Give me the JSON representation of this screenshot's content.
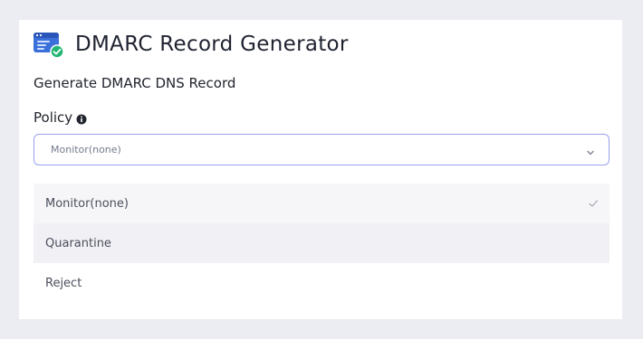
{
  "app": {
    "title": "DMARC Record Generator",
    "subtitle": "Generate DMARC DNS Record",
    "logo_icon": "browser-check-icon"
  },
  "policy": {
    "label": "Policy",
    "info_icon": "info-icon",
    "select": {
      "value": "Monitor(none)",
      "expanded": true
    },
    "options": [
      {
        "label": "Monitor(none)",
        "selected": true
      },
      {
        "label": "Quarantine",
        "selected": false,
        "hovered": true
      },
      {
        "label": "Reject",
        "selected": false
      }
    ]
  },
  "colors": {
    "accent": "#98a2ee",
    "brand_blue": "#3b6fd9",
    "check_green": "#22b573"
  }
}
